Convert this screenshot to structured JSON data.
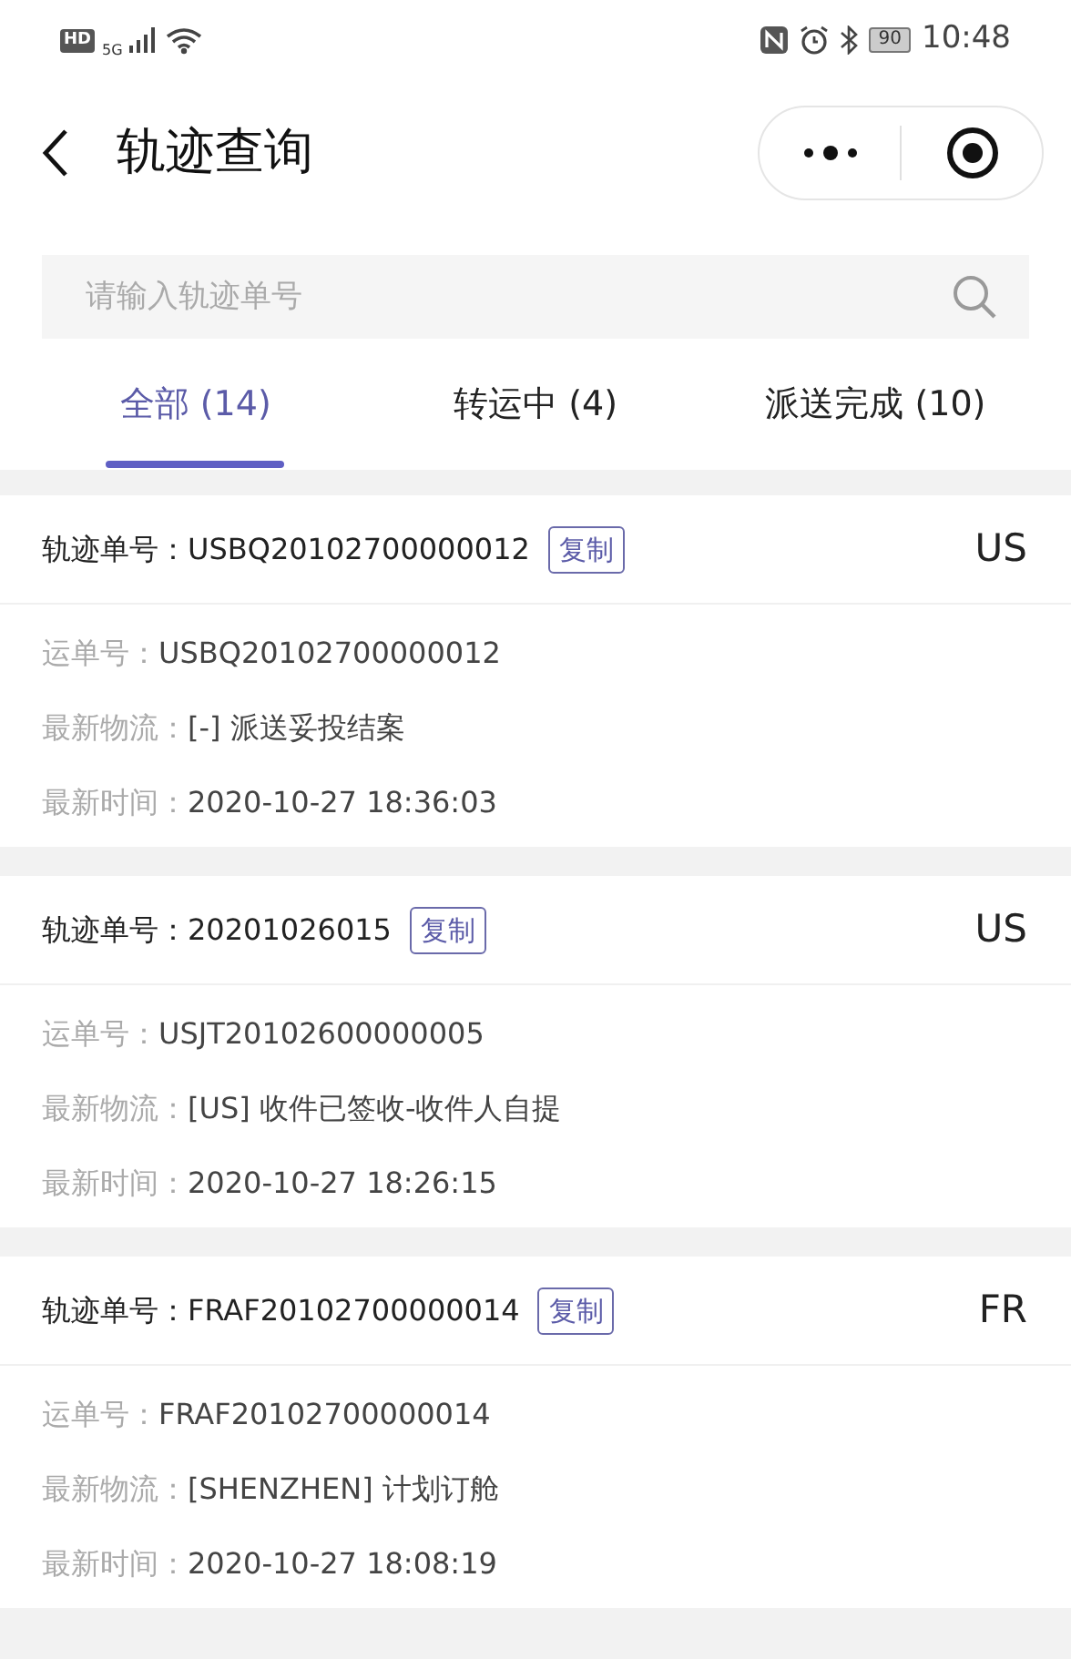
{
  "status_bar": {
    "hd": "HD",
    "network": "5G",
    "battery": "90",
    "time": "10:48"
  },
  "nav": {
    "title": "轨迹查询"
  },
  "search": {
    "placeholder": "请输入轨迹单号"
  },
  "tabs": [
    {
      "label": "全部 (14)",
      "selected": true
    },
    {
      "label": "转运中 (4)",
      "selected": false
    },
    {
      "label": "派送完成 (10)",
      "selected": false
    }
  ],
  "records": [
    {
      "track_label": "轨迹单号：",
      "track_no": "USBQ20102700000012",
      "copy": "复制",
      "country": "US",
      "fields": [
        {
          "label": "运单号：",
          "value": "USBQ20102700000012"
        },
        {
          "label": "最新物流：",
          "value": "[-] 派送妥投结案"
        },
        {
          "label": "最新时间：",
          "value": "2020-10-27 18:36:03"
        }
      ]
    },
    {
      "track_label": "轨迹单号：",
      "track_no": "20201026015",
      "copy": "复制",
      "country": "US",
      "fields": [
        {
          "label": "运单号：",
          "value": "USJT20102600000005"
        },
        {
          "label": "最新物流：",
          "value": "[US] 收件已签收-收件人自提"
        },
        {
          "label": "最新时间：",
          "value": "2020-10-27 18:26:15"
        }
      ]
    },
    {
      "track_label": "轨迹单号：",
      "track_no": "FRAF20102700000014",
      "copy": "复制",
      "country": "FR",
      "fields": [
        {
          "label": "运单号：",
          "value": "FRAF20102700000014"
        },
        {
          "label": "最新物流：",
          "value": "[SHENZHEN] 计划订舱"
        },
        {
          "label": "最新时间：",
          "value": "2020-10-27 18:08:19"
        }
      ]
    }
  ]
}
